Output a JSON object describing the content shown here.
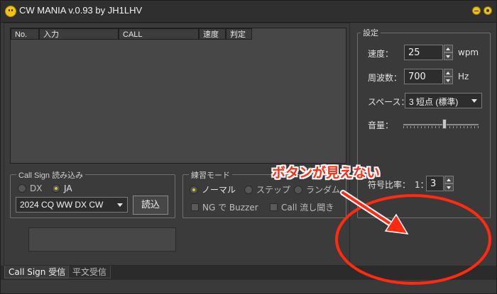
{
  "window": {
    "title": "CW MANIA v.0.93 by JH1LHV",
    "minimize_icon": "minimize-icon",
    "close_icon": "close-icon"
  },
  "table": {
    "columns": [
      "No.",
      "入力",
      "CALL",
      "速度",
      "判定"
    ],
    "rows": []
  },
  "callsign_group": {
    "title": "Call Sign 読み込み",
    "radio_dx": "DX",
    "radio_ja": "JA",
    "selected": "JA",
    "contest_select": "2024 CQ WW DX CW",
    "load_button": "読込"
  },
  "practice_group": {
    "title": "練習モード",
    "radio_normal": "ノーマル",
    "radio_step": "ステップ",
    "radio_random": "ランダム",
    "selected": "ノーマル",
    "check_ng_buzzer": "NG で Buzzer",
    "check_call_flow": "Call 流し聞き"
  },
  "settings": {
    "title": "設定",
    "speed_label": "速度：",
    "speed_value": "25",
    "speed_unit": "wpm",
    "freq_label": "周波数：",
    "freq_value": "700",
    "freq_unit": "Hz",
    "space_label": "スペース：",
    "space_value": "3 短点 (標準)",
    "volume_label": "音量：",
    "volume_level": 0.55,
    "ratio_label": "符号比率：",
    "ratio_prefix": "1：",
    "ratio_value": "3"
  },
  "tabs": [
    "Call Sign 受信",
    "平文受信"
  ],
  "annotation": {
    "text": "ボタンが見えない",
    "color": "#ff2a10"
  },
  "colors": {
    "window_bg": "#3a3a3a",
    "accent_radio": "#e3c12a",
    "annotation_red": "#ff2a10"
  }
}
